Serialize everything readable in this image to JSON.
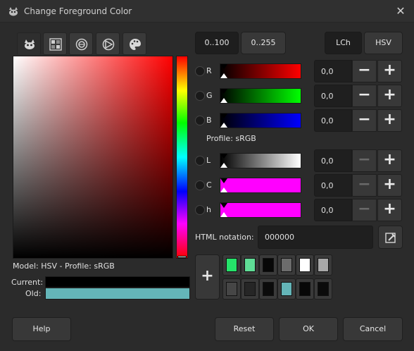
{
  "window": {
    "title": "Change Foreground Color",
    "close_glyph": "✕"
  },
  "model_label": "Model: HSV - Profile: sRGB",
  "current_label": "Current:",
  "old_label": "Old:",
  "colors": {
    "current": "#000000",
    "old": "#64b5b8",
    "selected_hue": "#ff0000"
  },
  "range_buttons": {
    "range_100": "0..100",
    "range_255": "0..255"
  },
  "model_buttons": {
    "lch": "LCh",
    "hsv": "HSV"
  },
  "channels": [
    {
      "key": "R",
      "value": "0,0",
      "from": "#000000",
      "to": "#ff0000",
      "minus_enabled": true
    },
    {
      "key": "G",
      "value": "0,0",
      "from": "#000000",
      "to": "#00ff00",
      "minus_enabled": true
    },
    {
      "key": "B",
      "value": "0,0",
      "from": "#000000",
      "to": "#0000ff",
      "minus_enabled": true
    },
    {
      "key": "L",
      "value": "0,0",
      "from": "#000000",
      "to": "#ffffff",
      "minus_enabled": false
    },
    {
      "key": "C",
      "value": "0,0",
      "from": "#ff00ff",
      "to": "#ff00ff",
      "minus_enabled": false
    },
    {
      "key": "h",
      "value": "0,0",
      "from": "#ff00ff",
      "to": "#ff00ff",
      "minus_enabled": false
    }
  ],
  "profile_label": "Profile: sRGB",
  "html_notation": {
    "label": "HTML notation:",
    "value": "000000"
  },
  "history_swatches": [
    "#25e36a",
    "#5fdc96",
    "#070707",
    "#6c6c6c",
    "#ffffff",
    "#a8a8a8",
    "#464646",
    "#262626",
    "#0b0b0b",
    "#64b5b8",
    "#070707",
    "#0b0b0b"
  ],
  "buttons": {
    "help": "Help",
    "reset": "Reset",
    "ok": "OK",
    "cancel": "Cancel",
    "plus": "+",
    "minus": "−"
  }
}
